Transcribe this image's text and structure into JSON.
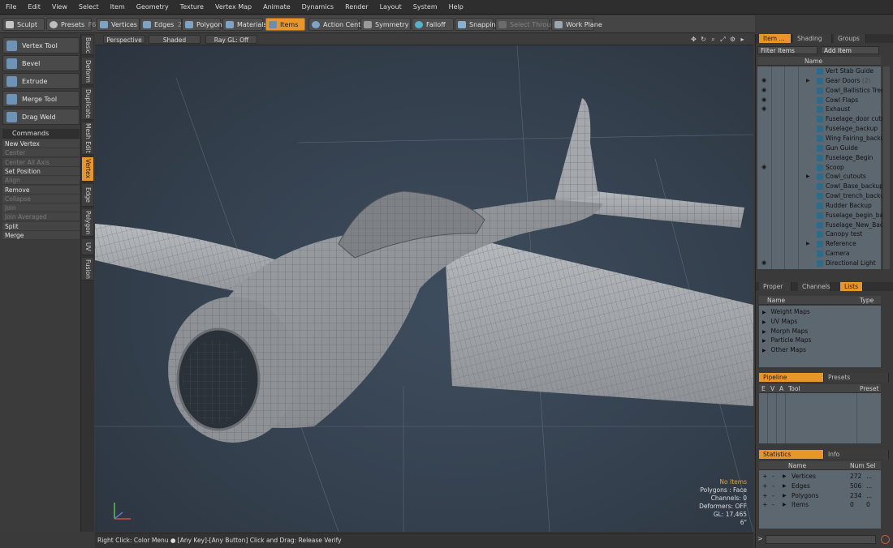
{
  "menu": [
    "File",
    "Edit",
    "View",
    "Select",
    "Item",
    "Geometry",
    "Texture",
    "Vertex Map",
    "Animate",
    "Dynamics",
    "Render",
    "Layout",
    "System",
    "Help"
  ],
  "toolbar": {
    "sculpt": "Sculpt",
    "presets": "Presets",
    "presets_key": "F6",
    "vertices": "Vertices",
    "vertices_num": "1",
    "edges": "Edges",
    "edges_num": "2",
    "polygons": "Polygons",
    "materials": "Materials",
    "items": "Items",
    "action_center": "Action Center",
    "symmetry": "Symmetry",
    "falloff": "Falloff",
    "snapping": "Snapping",
    "select_through": "Select Through",
    "work_plane": "Work Plane"
  },
  "tools": [
    "Vertex Tool",
    "Bevel",
    "Extrude",
    "Merge Tool",
    "Drag Weld"
  ],
  "commands_header": "Commands",
  "commands": [
    {
      "label": "New Vertex",
      "enabled": true
    },
    {
      "label": "Center",
      "enabled": false
    },
    {
      "label": "Center All Axis",
      "enabled": false
    },
    {
      "label": "Set Position",
      "enabled": true
    },
    {
      "label": "Align",
      "enabled": false
    },
    {
      "label": "Remove",
      "enabled": true
    },
    {
      "label": "Collapse",
      "enabled": false
    },
    {
      "label": "Join",
      "enabled": false
    },
    {
      "label": "Join Averaged",
      "enabled": false
    },
    {
      "label": "Split",
      "enabled": true
    },
    {
      "label": "Merge",
      "enabled": true
    }
  ],
  "vtabs": [
    "Basic",
    "Deform",
    "Duplicate",
    "Mesh Edit",
    "Vertex",
    "Edge",
    "Polygon",
    "UV",
    "Fusion"
  ],
  "vtab_active": "Vertex",
  "viewport": {
    "view": "Perspective",
    "shading": "Shaded",
    "raygl": "Ray GL: Off",
    "info": [
      "No Items",
      "Polygons : Face",
      "Channels: 0",
      "Deformers: OFF",
      "GL: 17,465",
      "6\""
    ]
  },
  "statusbar": "Right Click: Color Menu ●  [Any Key]-[Any Button] Click and Drag: Release Verify",
  "items_panel": {
    "tabs": [
      "Item ...",
      "Shading",
      "Groups"
    ],
    "filter": "Filter Items",
    "add": "Add Item",
    "col_name": "Name",
    "rows": [
      {
        "name": "Vert Stab Guide",
        "eye": false,
        "arrow": false
      },
      {
        "name": "Gear Doors",
        "count": "(2)",
        "eye": true,
        "arrow": true
      },
      {
        "name": "Cowl_Ballistics Trench_r",
        "eye": true,
        "arrow": false
      },
      {
        "name": "Cowl Flaps",
        "eye": true,
        "arrow": false
      },
      {
        "name": "Exhaust",
        "eye": true,
        "arrow": false
      },
      {
        "name": "Fuselage_door cutouts",
        "eye": false,
        "arrow": false
      },
      {
        "name": "Fuselage_backup",
        "eye": false,
        "arrow": false
      },
      {
        "name": "Wing Fairing_backukp",
        "eye": false,
        "arrow": false
      },
      {
        "name": "Gun Guide",
        "eye": false,
        "arrow": false
      },
      {
        "name": "Fuselage_Begin",
        "eye": false,
        "arrow": false
      },
      {
        "name": "Scoop",
        "eye": true,
        "arrow": false
      },
      {
        "name": "Cowl_cutouts",
        "eye": false,
        "arrow": true
      },
      {
        "name": "Cowl_Base_backup",
        "eye": false,
        "arrow": false
      },
      {
        "name": "Cowl_trench_backup",
        "eye": false,
        "arrow": false
      },
      {
        "name": "Rudder Backup",
        "eye": false,
        "arrow": false
      },
      {
        "name": "Fuselage_begin_backup",
        "eye": false,
        "arrow": false
      },
      {
        "name": "Fuselage_New_Backup",
        "eye": false,
        "arrow": false
      },
      {
        "name": "Canopy test",
        "eye": false,
        "arrow": false
      },
      {
        "name": "Reference",
        "eye": false,
        "arrow": true
      },
      {
        "name": "Camera",
        "eye": false,
        "arrow": false
      },
      {
        "name": "Directional Light",
        "eye": true,
        "arrow": false
      }
    ]
  },
  "lists_panel": {
    "tabs": [
      "Proper ...",
      "Channels",
      "Lists"
    ],
    "col_name": "Name",
    "col_type": "Type",
    "rows": [
      "Weight Maps",
      "UV Maps",
      "Morph Maps",
      "Particle Maps",
      "Other Maps"
    ]
  },
  "pipeline_panel": {
    "tabs": [
      "Pipeline",
      "Presets"
    ],
    "cols": [
      "E",
      "V",
      "A",
      "Tool",
      "Preset"
    ]
  },
  "stats_panel": {
    "tabs": [
      "Statistics",
      "Info"
    ],
    "cols": [
      "Name",
      "Num",
      "Sel"
    ],
    "rows": [
      {
        "name": "Vertices",
        "num": "272",
        "sel": "..."
      },
      {
        "name": "Edges",
        "num": "506",
        "sel": "..."
      },
      {
        "name": "Polygons",
        "num": "234",
        "sel": "..."
      },
      {
        "name": "Items",
        "num": "0",
        "sel": "0"
      }
    ]
  },
  "command_prompt": ">",
  "colors": {
    "accent": "#e8962a",
    "viewport": "#34404e",
    "panel": "#3a3a3a"
  }
}
